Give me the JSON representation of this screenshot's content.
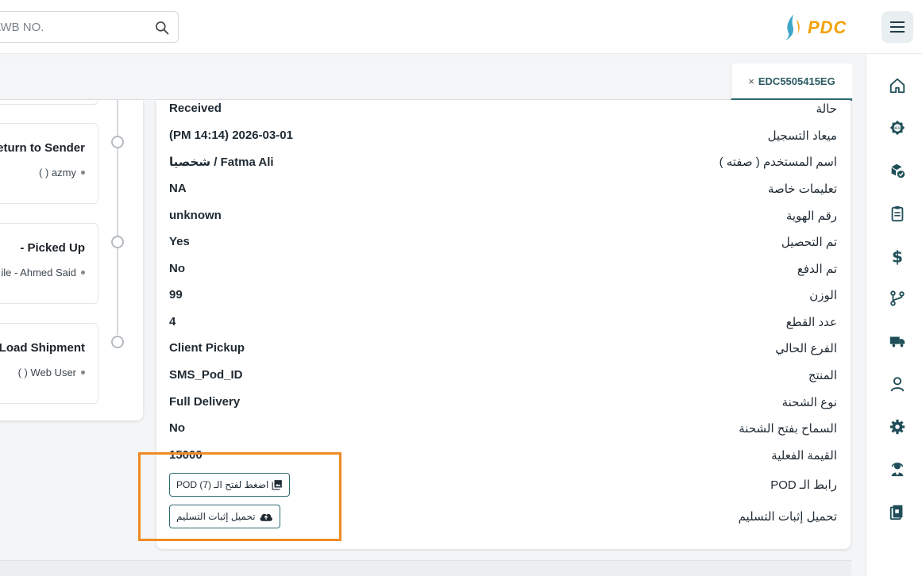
{
  "header": {
    "search_placeholder": "AWB NO.",
    "logo_text": "PDC",
    "icons": {
      "search": "search-icon",
      "menu": "hamburger-menu-icon"
    }
  },
  "tabs": [
    {
      "label": "EDC5505415EG",
      "close": "×"
    }
  ],
  "timeline": [
    {
      "title": "Return to Sender",
      "sub": "( ) azmy"
    },
    {
      "title": "- Picked Up",
      "sub": "ile - Ahmed Said"
    },
    {
      "title": "- Load Shipment",
      "sub": "( ) Web User"
    }
  ],
  "details": [
    {
      "label": "حالة",
      "value": "Received"
    },
    {
      "label": "ميعاد التسجيل",
      "value": "(PM 14:14) 2026-03-01"
    },
    {
      "label": "اسم المستخدم ( صفته )",
      "value": "شخصيا / Fatma Ali"
    },
    {
      "label": "تعليمات خاصة",
      "value": "NA"
    },
    {
      "label": "رقم الهوية",
      "value": "unknown"
    },
    {
      "label": "تم التحصيل",
      "value": "Yes"
    },
    {
      "label": "تم الدفع",
      "value": "No"
    },
    {
      "label": "الوزن",
      "value": "99"
    },
    {
      "label": "عدد القطع",
      "value": "4"
    },
    {
      "label": "الفرع الحالي",
      "value": "Client Pickup"
    },
    {
      "label": "المنتج",
      "value": "SMS_Pod_ID"
    },
    {
      "label": "نوع الشحنة",
      "value": "Full Delivery"
    },
    {
      "label": "السماح بفتح الشحنة",
      "value": "No"
    },
    {
      "label": "القيمة الفعلية",
      "value": "15000"
    }
  ],
  "pod": {
    "link_label": "رابط الـ POD",
    "link_button": "اضغط لفتح الـ (7) POD",
    "upload_label": "تحميل إثبات التسليم",
    "upload_button": "تحميل إثبات التسليم"
  },
  "sidebar_icons": [
    "home-icon",
    "new-badge-icon",
    "boxes-check-icon",
    "clipboard-icon",
    "dollar-icon",
    "branch-icon",
    "truck-icon",
    "user-icon",
    "gear-icon",
    "support-agent-icon",
    "document-stack-icon"
  ],
  "colors": {
    "accent": "#2d6a73",
    "brand_orange": "#f2a20a",
    "highlight": "#f08a24"
  }
}
